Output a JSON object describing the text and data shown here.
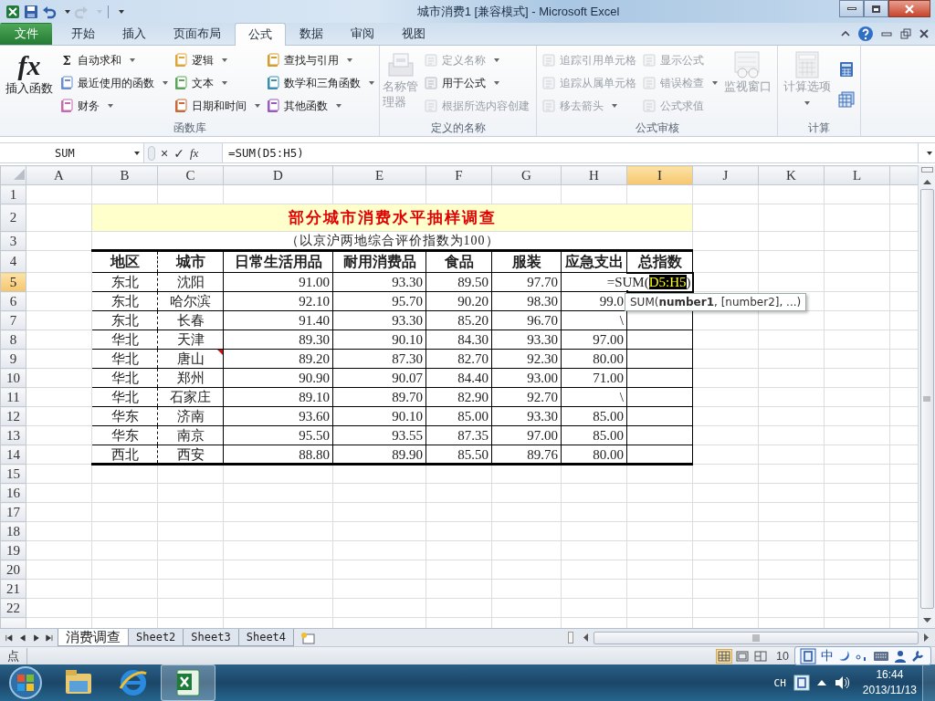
{
  "title_bar": {
    "title": "城市消费1  [兼容模式] - Microsoft Excel"
  },
  "ribbon_tabs": [
    {
      "label": "文件",
      "kind": "file",
      "selected": false
    },
    {
      "label": "开始",
      "kind": "tab",
      "selected": false
    },
    {
      "label": "插入",
      "kind": "tab",
      "selected": false
    },
    {
      "label": "页面布局",
      "kind": "tab",
      "selected": false
    },
    {
      "label": "公式",
      "kind": "tab",
      "selected": true
    },
    {
      "label": "数据",
      "kind": "tab",
      "selected": false
    },
    {
      "label": "审阅",
      "kind": "tab",
      "selected": false
    },
    {
      "label": "视图",
      "kind": "tab",
      "selected": false
    }
  ],
  "ribbon_groups": [
    {
      "label": "函数库",
      "columns": [
        {
          "kind": "large",
          "items": [
            {
              "label": "插入函数",
              "icon_text": "fx",
              "dropdown": false,
              "disabled": false
            }
          ]
        },
        {
          "kind": "stack",
          "items": [
            {
              "label": "自动求和",
              "icon_text": "Σ",
              "dropdown": true,
              "disabled": false
            },
            {
              "label": "最近使用的函数",
              "dropdown": true,
              "disabled": false
            },
            {
              "label": "财务",
              "dropdown": true,
              "disabled": false
            }
          ]
        },
        {
          "kind": "stack",
          "items": [
            {
              "label": "逻辑",
              "dropdown": true,
              "disabled": false
            },
            {
              "label": "文本",
              "dropdown": true,
              "disabled": false
            },
            {
              "label": "日期和时间",
              "dropdown": true,
              "disabled": false
            }
          ]
        },
        {
          "kind": "stack",
          "items": [
            {
              "label": "查找与引用",
              "dropdown": true,
              "disabled": false
            },
            {
              "label": "数学和三角函数",
              "dropdown": true,
              "disabled": false
            },
            {
              "label": "其他函数",
              "dropdown": true,
              "disabled": false
            }
          ]
        }
      ]
    },
    {
      "label": "定义的名称",
      "columns": [
        {
          "kind": "large",
          "items": [
            {
              "label": "名称管理器",
              "dropdown": false,
              "disabled": true
            }
          ]
        },
        {
          "kind": "stack",
          "items": [
            {
              "label": "定义名称",
              "dropdown": true,
              "disabled": true
            },
            {
              "label": "用于公式",
              "dropdown": true,
              "disabled": false
            },
            {
              "label": "根据所选内容创建",
              "dropdown": false,
              "disabled": true
            }
          ]
        }
      ]
    },
    {
      "label": "公式审核",
      "columns": [
        {
          "kind": "stack",
          "items": [
            {
              "label": "追踪引用单元格",
              "dropdown": false,
              "disabled": true
            },
            {
              "label": "追踪从属单元格",
              "dropdown": false,
              "disabled": true
            },
            {
              "label": "移去箭头",
              "dropdown": true,
              "disabled": true
            }
          ]
        },
        {
          "kind": "stack",
          "items": [
            {
              "label": "显示公式",
              "dropdown": false,
              "disabled": true
            },
            {
              "label": "错误检查",
              "dropdown": true,
              "disabled": true
            },
            {
              "label": "公式求值",
              "dropdown": false,
              "disabled": true
            }
          ]
        },
        {
          "kind": "large",
          "items": [
            {
              "label": "监视窗口",
              "dropdown": false,
              "disabled": true
            }
          ]
        }
      ]
    },
    {
      "label": "计算",
      "columns": [
        {
          "kind": "large",
          "items": [
            {
              "label": "计算选项",
              "dropdown": true,
              "disabled": true
            }
          ]
        },
        {
          "kind": "icons",
          "items": [
            {
              "disabled": false
            },
            {
              "disabled": false
            }
          ]
        }
      ]
    }
  ],
  "formula_bar": {
    "name_box": "SUM",
    "buttons": [
      "×",
      "✓",
      "fx"
    ],
    "formula": "=SUM(D5:H5)"
  },
  "sheet": {
    "columns": [
      {
        "label": "A",
        "selected": false
      },
      {
        "label": "B",
        "selected": false
      },
      {
        "label": "C",
        "selected": false
      },
      {
        "label": "D",
        "selected": false
      },
      {
        "label": "E",
        "selected": false
      },
      {
        "label": "F",
        "selected": false
      },
      {
        "label": "G",
        "selected": false
      },
      {
        "label": "H",
        "selected": false
      },
      {
        "label": "I",
        "selected": true
      },
      {
        "label": "J",
        "selected": false
      },
      {
        "label": "K",
        "selected": false
      },
      {
        "label": "L",
        "selected": false
      }
    ],
    "rows": [
      {
        "label": "1",
        "selected": false
      },
      {
        "label": "2",
        "selected": false
      },
      {
        "label": "3",
        "selected": false
      },
      {
        "label": "4",
        "selected": false
      },
      {
        "label": "5",
        "selected": true
      },
      {
        "label": "6",
        "selected": false
      },
      {
        "label": "7",
        "selected": false
      },
      {
        "label": "8",
        "selected": false
      },
      {
        "label": "9",
        "selected": false
      },
      {
        "label": "10",
        "selected": false
      },
      {
        "label": "11",
        "selected": false
      },
      {
        "label": "12",
        "selected": false
      },
      {
        "label": "13",
        "selected": false
      },
      {
        "label": "14",
        "selected": false
      },
      {
        "label": "15",
        "selected": false
      },
      {
        "label": "16",
        "selected": false
      },
      {
        "label": "17",
        "selected": false
      },
      {
        "label": "18",
        "selected": false
      },
      {
        "label": "19",
        "selected": false
      },
      {
        "label": "20",
        "selected": false
      },
      {
        "label": "21",
        "selected": false
      },
      {
        "label": "22",
        "selected": false
      }
    ],
    "title": "部分城市消费水平抽样调查",
    "subtitle": "（以京沪两地综合评价指数为100）",
    "headers": [
      "地区",
      "城市",
      "日常生活用品",
      "耐用消费品",
      "食品",
      "服装",
      "应急支出",
      "总指数"
    ],
    "records": [
      {
        "cells": [
          "东北",
          "沈阳",
          "91.00",
          "93.30",
          "89.50",
          "97.70",
          ""
        ],
        "comment": false
      },
      {
        "cells": [
          "东北",
          "哈尔滨",
          "92.10",
          "95.70",
          "90.20",
          "98.30",
          "99.0"
        ],
        "comment": false
      },
      {
        "cells": [
          "东北",
          "长春",
          "91.40",
          "93.30",
          "85.20",
          "96.70",
          "\\"
        ],
        "comment": false
      },
      {
        "cells": [
          "华北",
          "天津",
          "89.30",
          "90.10",
          "84.30",
          "93.30",
          "97.00"
        ],
        "comment": false
      },
      {
        "cells": [
          "华北",
          "唐山",
          "89.20",
          "87.30",
          "82.70",
          "92.30",
          "80.00"
        ],
        "comment": true
      },
      {
        "cells": [
          "华北",
          "郑州",
          "90.90",
          "90.07",
          "84.40",
          "93.00",
          "71.00"
        ],
        "comment": false
      },
      {
        "cells": [
          "华北",
          "石家庄",
          "89.10",
          "89.70",
          "82.90",
          "92.70",
          "\\"
        ],
        "comment": false
      },
      {
        "cells": [
          "华东",
          "济南",
          "93.60",
          "90.10",
          "85.00",
          "93.30",
          "85.00"
        ],
        "comment": false
      },
      {
        "cells": [
          "华东",
          "南京",
          "95.50",
          "93.55",
          "87.35",
          "97.00",
          "85.00"
        ],
        "comment": false
      },
      {
        "cells": [
          "西北",
          "西安",
          "88.80",
          "89.90",
          "85.50",
          "89.76",
          "80.00"
        ],
        "comment": false
      }
    ],
    "active_cell": {
      "before": "=SUM(",
      "reference": "D5:H5",
      "after": ")"
    },
    "tooltip": "SUM(**number1**, [number2], ...)"
  },
  "sheet_tabs": [
    {
      "label": "消费调查",
      "selected": true
    },
    {
      "label": "Sheet2",
      "selected": false
    },
    {
      "label": "Sheet3",
      "selected": false
    },
    {
      "label": "Sheet4",
      "selected": false
    }
  ],
  "status_bar": {
    "mode": "点",
    "views": [
      {
        "selected": true
      },
      {
        "selected": false
      },
      {
        "selected": false
      }
    ],
    "zoom": "10"
  },
  "ime_bar": {
    "label": "中"
  },
  "taskbar": {
    "apps": [
      {
        "selected": false
      },
      {
        "selected": false
      },
      {
        "selected": true
      }
    ],
    "language": "CH",
    "time": "16:44",
    "date": "2013/11/13"
  }
}
